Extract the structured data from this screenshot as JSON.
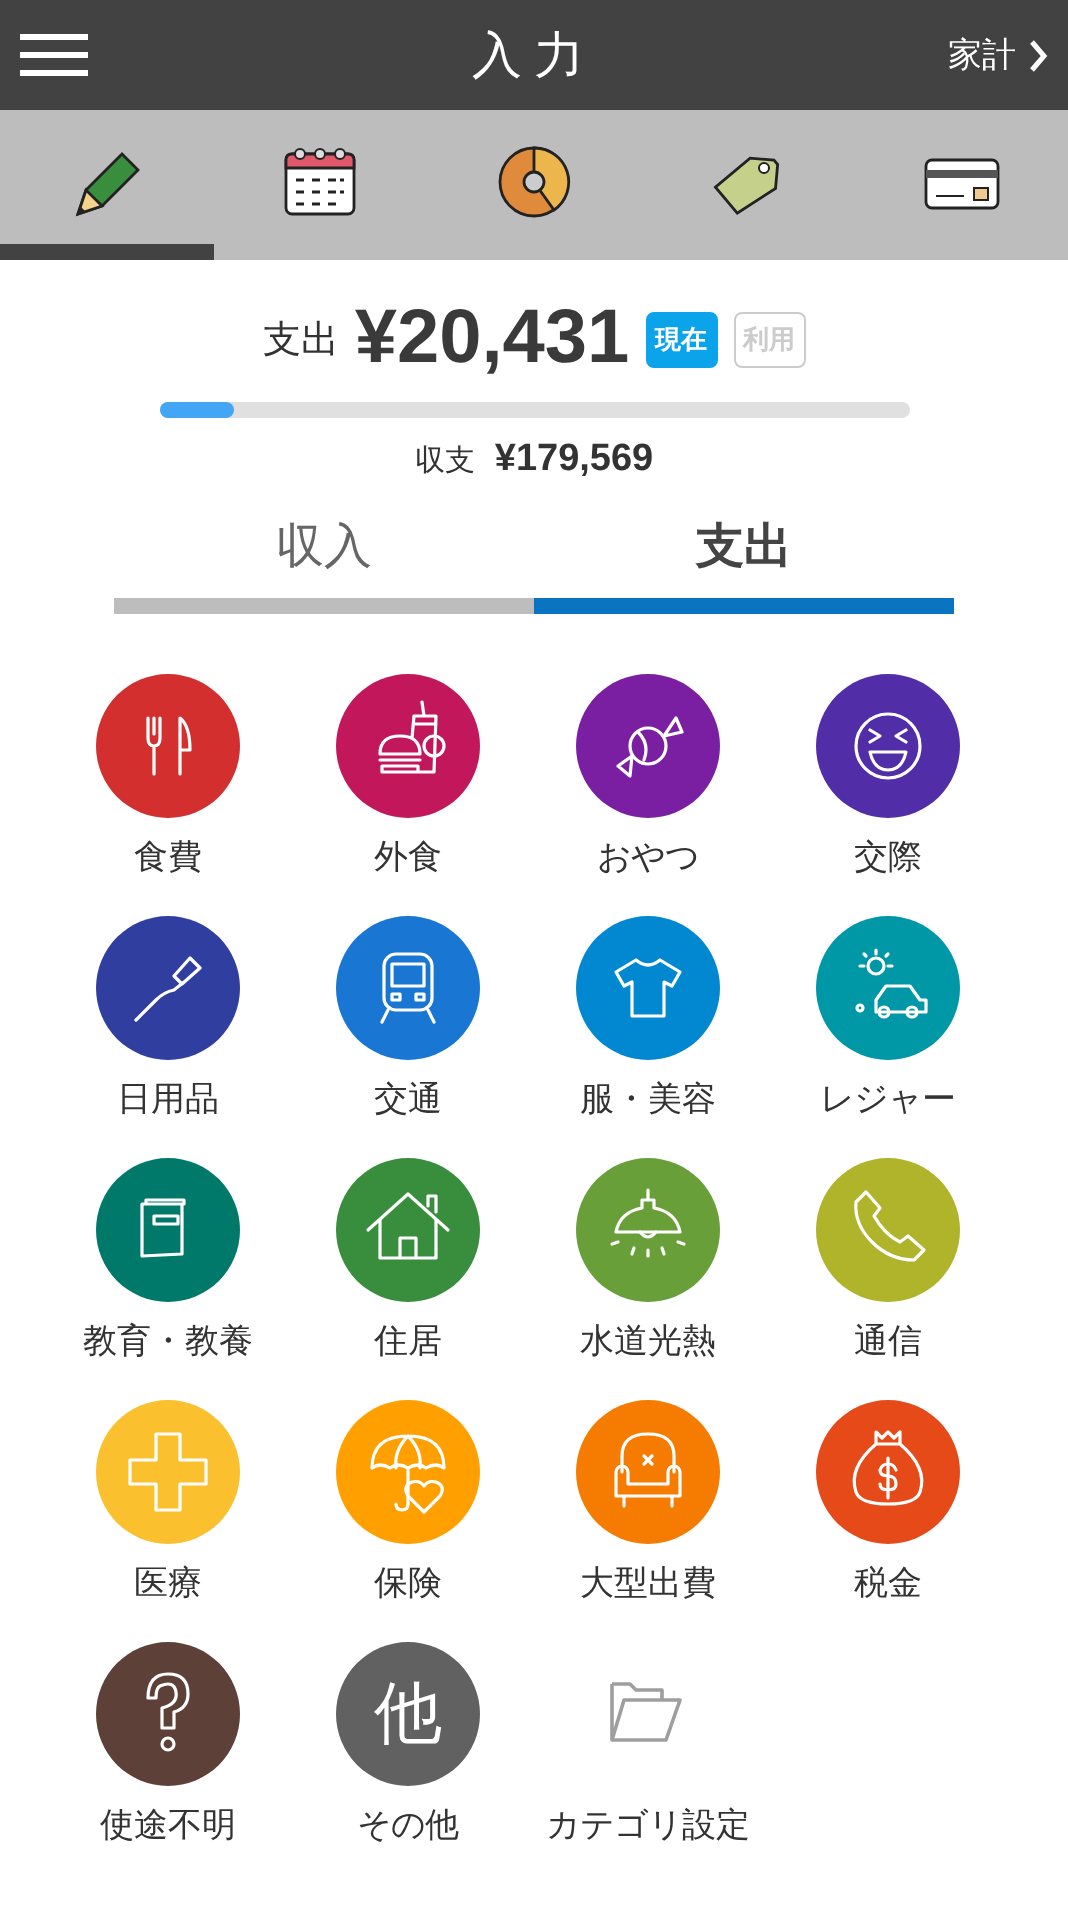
{
  "header": {
    "title": "入力",
    "link": "家計"
  },
  "toolbar": [
    {
      "selected": true
    },
    {
      "selected": false
    },
    {
      "selected": false
    },
    {
      "selected": false
    },
    {
      "selected": false
    }
  ],
  "summary": {
    "label": "支出",
    "amount": "¥20,431",
    "badges": [
      {
        "label": "現在",
        "selected": true
      },
      {
        "label": "利用",
        "selected": false
      }
    ],
    "level": 0.1,
    "balance_label": "収支",
    "balance": "¥179,569"
  },
  "segments": [
    {
      "label": "収入",
      "selected": false
    },
    {
      "label": "支出",
      "selected": true
    }
  ],
  "categories": [
    {
      "kind": "category",
      "label": "食費",
      "color": "#d32f2f"
    },
    {
      "kind": "category",
      "label": "外食",
      "color": "#c2185b"
    },
    {
      "kind": "category",
      "label": "おやつ",
      "color": "#7b1fa2"
    },
    {
      "kind": "category",
      "label": "交際",
      "color": "#512da8"
    },
    {
      "kind": "category",
      "label": "日用品",
      "color": "#303f9f"
    },
    {
      "kind": "category",
      "label": "交通",
      "color": "#1976d2"
    },
    {
      "kind": "category",
      "label": "服・美容",
      "color": "#0288d1"
    },
    {
      "kind": "category",
      "label": "レジャー",
      "color": "#0097a7"
    },
    {
      "kind": "category",
      "label": "教育・教養",
      "color": "#00796b"
    },
    {
      "kind": "category",
      "label": "住居",
      "color": "#388e3c"
    },
    {
      "kind": "category",
      "label": "水道光熱",
      "color": "#689f38"
    },
    {
      "kind": "category",
      "label": "通信",
      "color": "#afb42b"
    },
    {
      "kind": "category",
      "label": "医療",
      "color": "#fbc02d"
    },
    {
      "kind": "category",
      "label": "保険",
      "color": "#ffa000"
    },
    {
      "kind": "category",
      "label": "大型出費",
      "color": "#f57c00"
    },
    {
      "kind": "category",
      "label": "税金",
      "color": "#e64a19"
    },
    {
      "kind": "category",
      "label": "使途不明",
      "color": "#5d4037"
    },
    {
      "kind": "other",
      "label": "その他",
      "color": "#616161"
    },
    {
      "kind": "settings",
      "label": "カテゴリ設定"
    }
  ],
  "other_glyph": "他"
}
